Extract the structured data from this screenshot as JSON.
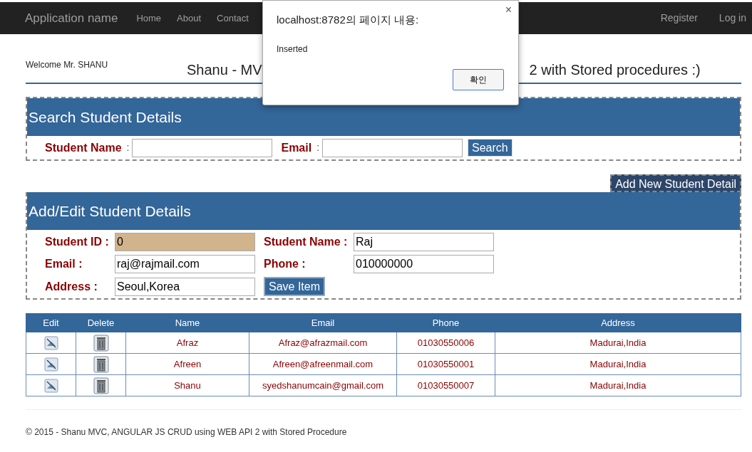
{
  "navbar": {
    "brand": "Application name",
    "links": [
      "Home",
      "About",
      "Contact"
    ],
    "right_links": [
      "Register",
      "Log in"
    ]
  },
  "welcome": "Welcome Mr. SHANU",
  "page_title": {
    "left": "Shanu - MV",
    "right": "2 with Stored procedures :)"
  },
  "search_panel": {
    "title": "Search Student Details",
    "fields": [
      {
        "label": "Student Name",
        "separator": ":"
      },
      {
        "label": "Email",
        "separator": ":"
      }
    ],
    "button": "Search"
  },
  "add_button": "Add New Student Detail",
  "edit_panel": {
    "title": "Add/Edit Student Details",
    "fields": [
      {
        "label": "Student ID :",
        "value": "0",
        "readonly": true
      },
      {
        "label": "Student Name :",
        "value": "Raj",
        "readonly": false
      },
      {
        "label": "Email :",
        "value": "raj@rajmail.com",
        "readonly": false
      },
      {
        "label": "Phone :",
        "value": "010000000",
        "readonly": false
      },
      {
        "label": "Address :",
        "value": "Seoul,Korea",
        "readonly": false
      }
    ],
    "button": "Save Item"
  },
  "table": {
    "columns": [
      "Edit",
      "Delete",
      "Name",
      "Email",
      "Phone",
      "Address"
    ],
    "rows": [
      {
        "name": "Afraz",
        "email": "Afraz@afrazmail.com",
        "phone": "01030550006",
        "address": "Madurai,India"
      },
      {
        "name": "Afreen",
        "email": "Afreen@afreenmail.com",
        "phone": "01030550001",
        "address": "Madurai,India"
      },
      {
        "name": "Shanu",
        "email": "syedshanumcain@gmail.com",
        "phone": "01030550007",
        "address": "Madurai,India"
      }
    ]
  },
  "footer": "© 2015 - Shanu MVC, ANGULAR JS CRUD using WEB API 2 with Stored Procedure",
  "dialog": {
    "title": "localhost:8782의 페이지 내용:",
    "close": "×",
    "message": "Inserted",
    "button": "확인"
  }
}
